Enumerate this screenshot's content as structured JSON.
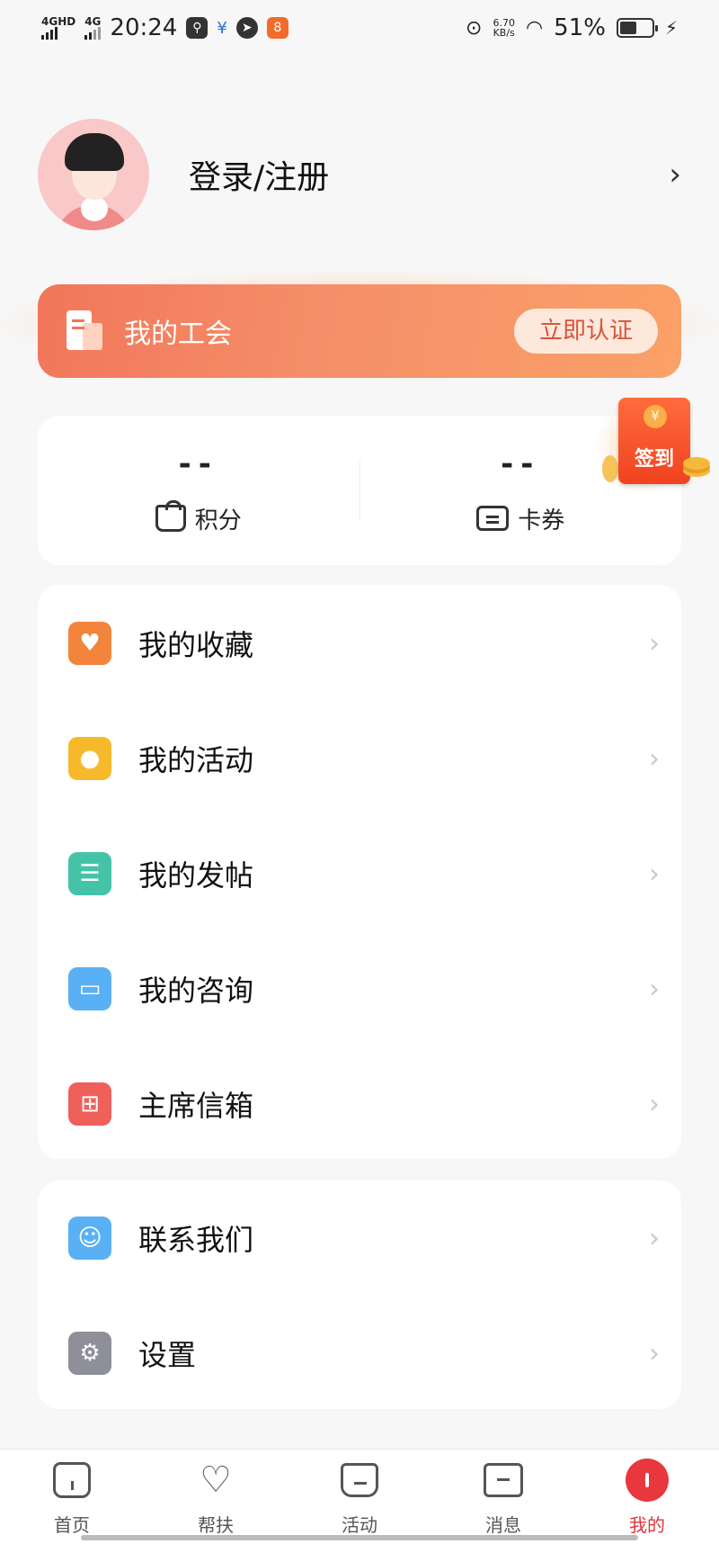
{
  "status_bar": {
    "signal1": "4GHD",
    "signal2": "4G",
    "time": "20:24",
    "speed_value": "6.70",
    "speed_unit": "KB/s",
    "battery": "51%"
  },
  "profile": {
    "login_label": "登录/注册",
    "chevron": "›"
  },
  "union": {
    "title": "我的工会",
    "verify_label": "立即认证"
  },
  "points": {
    "points_value": "--",
    "points_label": "积分",
    "coupons_value": "--",
    "coupons_label": "卡券"
  },
  "signin": {
    "label": "签到",
    "coin": "¥"
  },
  "menu_main": [
    {
      "label": "我的收藏",
      "icon": "heart-plus-icon",
      "color": "#f2853b"
    },
    {
      "label": "我的活动",
      "icon": "balloon-icon",
      "color": "#f6b92b"
    },
    {
      "label": "我的发帖",
      "icon": "clipboard-icon",
      "color": "#44c3a8"
    },
    {
      "label": "我的咨询",
      "icon": "chat-icon",
      "color": "#5ab0f5"
    },
    {
      "label": "主席信箱",
      "icon": "mailbox-icon",
      "color": "#f0605a"
    }
  ],
  "menu_other": [
    {
      "label": "联系我们",
      "icon": "robot-icon",
      "color": "#5ab0f5"
    },
    {
      "label": "设置",
      "icon": "gear-icon",
      "color": "#8f8f9a"
    }
  ],
  "arrow": "›",
  "nav": [
    {
      "label": "首页"
    },
    {
      "label": "帮扶"
    },
    {
      "label": "活动"
    },
    {
      "label": "消息"
    },
    {
      "label": "我的"
    }
  ]
}
